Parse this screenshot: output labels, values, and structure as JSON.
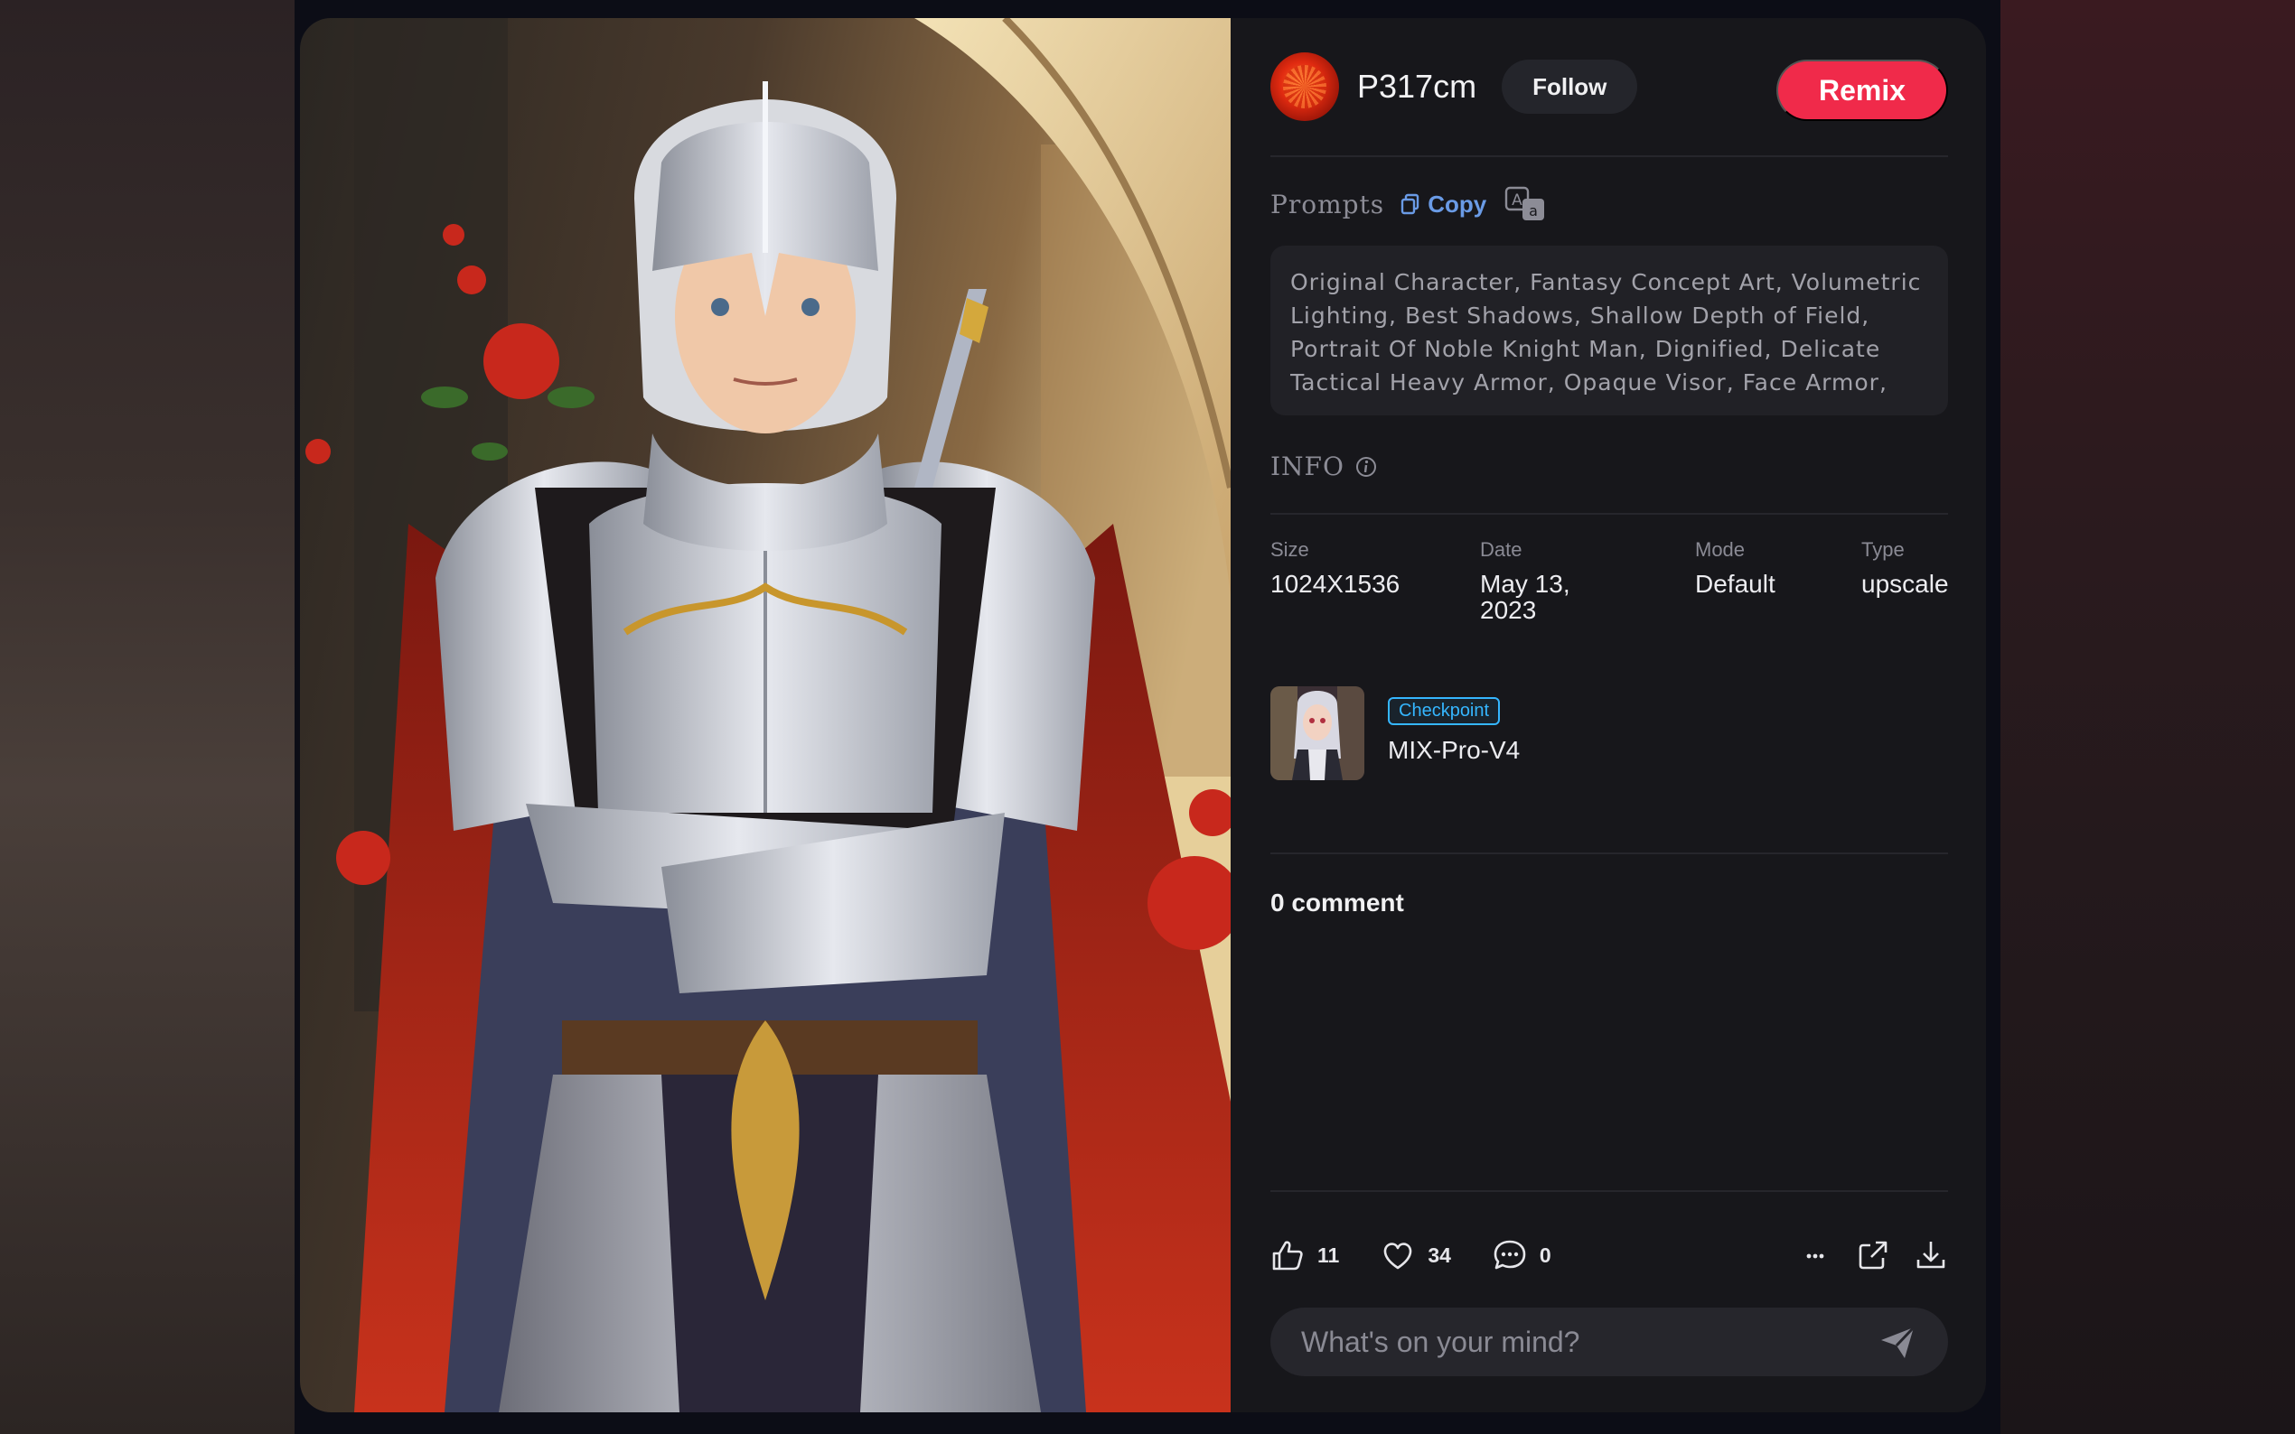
{
  "author": {
    "name": "P317cm",
    "follow_label": "Follow"
  },
  "remix_label": "Remix",
  "prompts": {
    "label": "Prompts",
    "copy_label": "Copy",
    "text": "Original Character, Fantasy Concept Art, Volumetric Lighting, Best Shadows, Shallow Depth of Field, Portrait Of Noble Knight Man, Dignified, Delicate Tactical Heavy Armor, Opaque Visor, Face Armor,"
  },
  "info": {
    "label": "INFO",
    "size_label": "Size",
    "size_value": "1024X1536",
    "date_label": "Date",
    "date_line1": "May 13,",
    "date_line2": "2023",
    "mode_label": "Mode",
    "mode_value": "Default",
    "type_label": "Type",
    "type_value": "upscale"
  },
  "model": {
    "badge": "Checkpoint",
    "name": "MIX-Pro-V4"
  },
  "comments": {
    "count_label": "0 comment",
    "placeholder": "What's on your mind?"
  },
  "actions": {
    "likes": "11",
    "favorites": "34",
    "comments": "0"
  },
  "icons": [
    "copy-icon",
    "translate-icon",
    "info-icon",
    "thumbs-up-icon",
    "heart-icon",
    "comment-icon",
    "more-icon",
    "share-icon",
    "download-icon",
    "send-icon"
  ],
  "colors": {
    "accent": "#f02a4a",
    "link": "#6a9be6",
    "badge": "#35b6ff",
    "panel": "#17171b"
  }
}
